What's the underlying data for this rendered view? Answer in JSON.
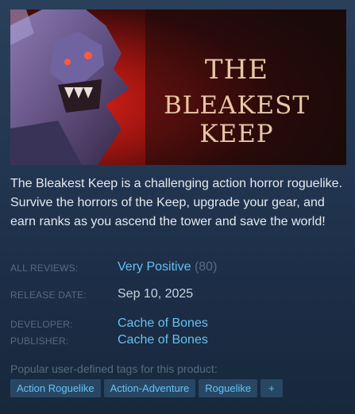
{
  "capsule": {
    "title_line1": "THE",
    "title_line2": "BLEAKEST KEEP"
  },
  "description": "The Bleakest Keep is a challenging action horror roguelike. Survive the horrors of the Keep, upgrade your gear, and earn ranks as you ascend the tower and save the world!",
  "reviews": {
    "label": "ALL REVIEWS:",
    "summary": "Very Positive",
    "count": "(80)"
  },
  "release": {
    "label": "RELEASE DATE:",
    "date": "Sep 10, 2025"
  },
  "developer": {
    "label": "DEVELOPER:",
    "name": "Cache of Bones"
  },
  "publisher": {
    "label": "PUBLISHER:",
    "name": "Cache of Bones"
  },
  "tags": {
    "label": "Popular user-defined tags for this product:",
    "items": [
      "Action Roguelike",
      "Action-Adventure",
      "Roguelike"
    ],
    "add": "+"
  },
  "colors": {
    "link": "#66c0f4",
    "label": "#556b80",
    "text": "#e4e9ee",
    "tag_bg": "rgba(103,193,245,0.2)"
  }
}
